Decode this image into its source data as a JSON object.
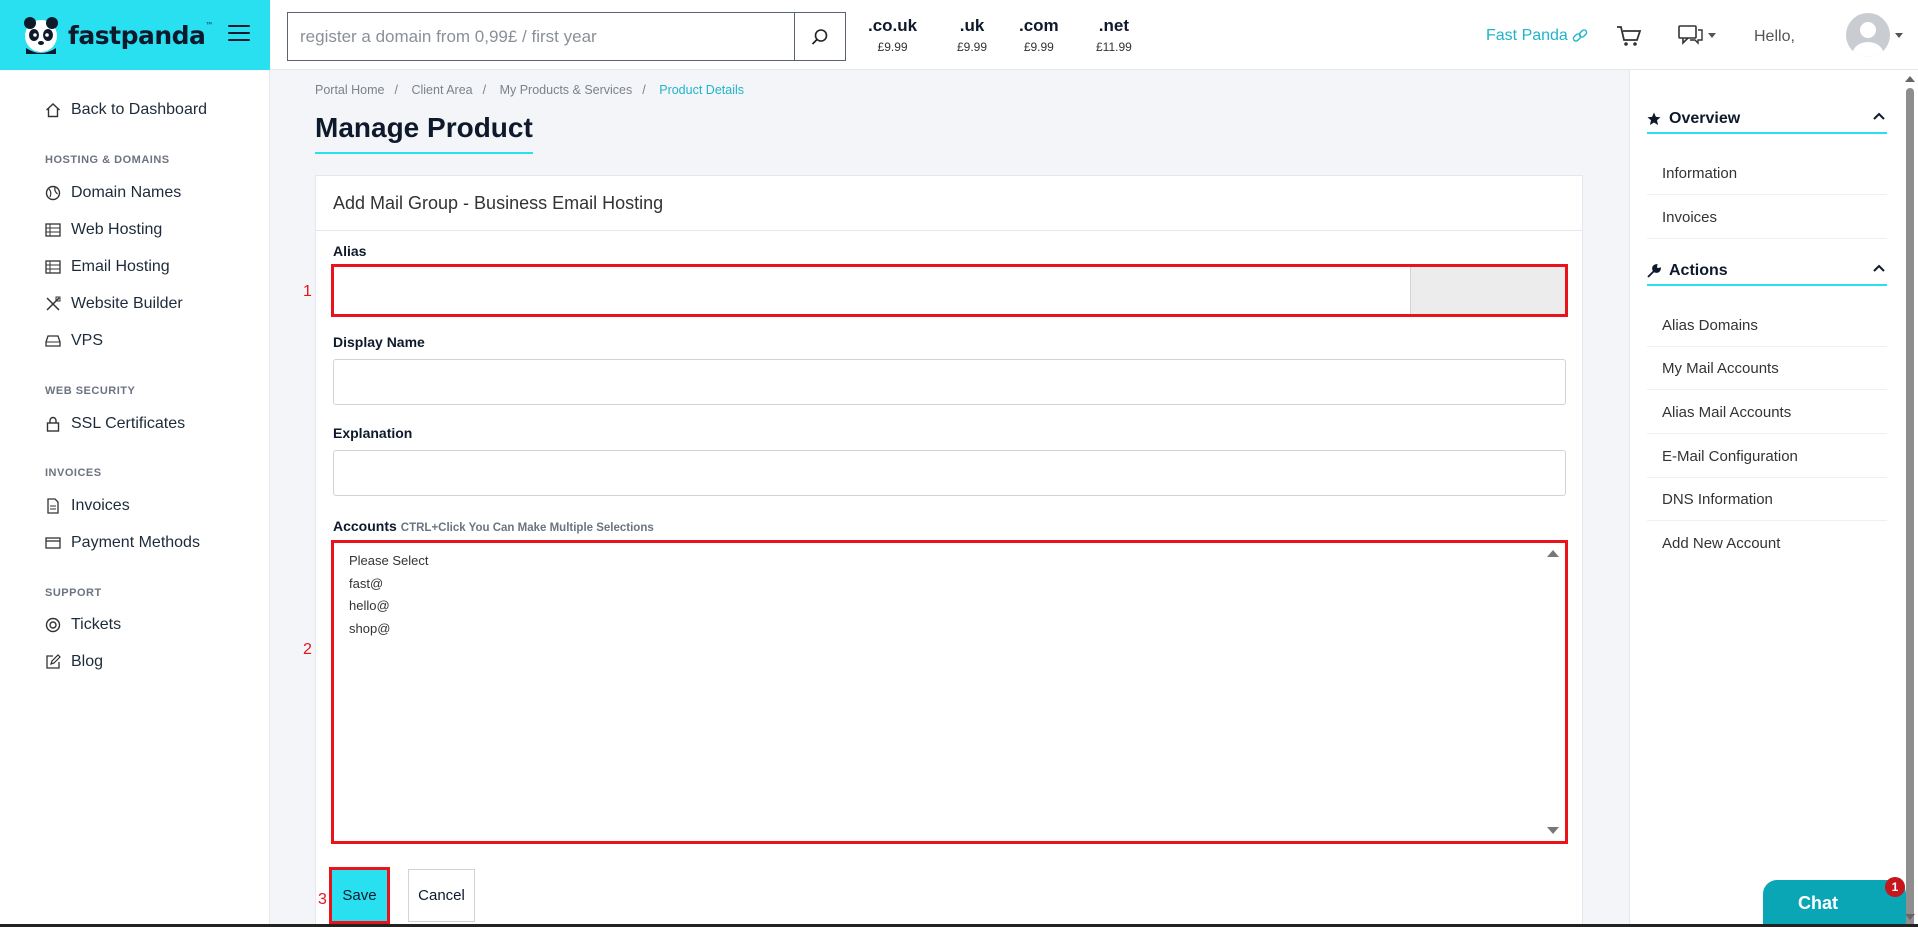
{
  "colors": {
    "brand": "#28e0f0",
    "highlight": "#e8131b",
    "link": "#1fb5c9",
    "chat": "#0aa6b5"
  },
  "header": {
    "logo_text": "fastpanda",
    "logo_tm": "™",
    "search_placeholder": "register a domain from 0,99£ / first year",
    "tlds": [
      {
        "name": ".co.uk",
        "price": "£9.99"
      },
      {
        "name": ".uk",
        "price": "£9.99"
      },
      {
        "name": ".com",
        "price": "£9.99"
      },
      {
        "name": ".net",
        "price": "£11.99"
      }
    ],
    "fast_panda_link": "Fast Panda",
    "hello": "Hello,"
  },
  "sidebar": {
    "back": "Back to Dashboard",
    "sections": [
      {
        "heading": "HOSTING & DOMAINS",
        "items": [
          "Domain Names",
          "Web Hosting",
          "Email Hosting",
          "Website Builder",
          "VPS"
        ]
      },
      {
        "heading": "WEB SECURITY",
        "items": [
          "SSL Certificates"
        ]
      },
      {
        "heading": "INVOICES",
        "items": [
          "Invoices",
          "Payment Methods"
        ]
      },
      {
        "heading": "SUPPORT",
        "items": [
          "Tickets",
          "Blog"
        ]
      }
    ]
  },
  "breadcrumb": [
    "Portal Home",
    "Client Area",
    "My Products & Services",
    "Product Details"
  ],
  "page_title": "Manage Product",
  "card": {
    "title": "Add Mail Group - Business Email Hosting",
    "alias_label": "Alias",
    "display_name_label": "Display Name",
    "explanation_label": "Explanation",
    "accounts_label": "Accounts",
    "accounts_hint": "CTRL+Click You Can Make Multiple Selections",
    "accounts_options": [
      "Please Select",
      "fast@",
      "hello@",
      "shop@"
    ],
    "save": "Save",
    "cancel": "Cancel"
  },
  "markers": [
    "1",
    "2",
    "3"
  ],
  "right_panel": {
    "overview": {
      "title": "Overview",
      "items": [
        "Information",
        "Invoices"
      ]
    },
    "actions": {
      "title": "Actions",
      "items": [
        "Alias Domains",
        "My Mail Accounts",
        "Alias Mail Accounts",
        "E-Mail Configuration",
        "DNS Information",
        "Add New Account"
      ]
    }
  },
  "chat_widget": {
    "label": "Chat",
    "badge": "1"
  }
}
